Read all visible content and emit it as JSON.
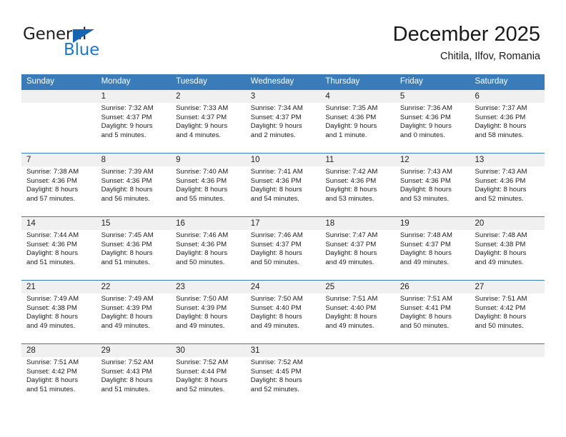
{
  "brand": {
    "name_part1": "General",
    "name_part2": "Blue",
    "triangle_color": "#1565b0",
    "text_color": "#231f20",
    "blue_color": "#2079c7"
  },
  "header": {
    "title": "December 2025",
    "subtitle": "Chitila, Ilfov, Romania",
    "header_bg": "#3a7cba",
    "daynum_bg": "#f0f0f0"
  },
  "weekdays": [
    "Sunday",
    "Monday",
    "Tuesday",
    "Wednesday",
    "Thursday",
    "Friday",
    "Saturday"
  ],
  "weeks": [
    {
      "days": [
        {
          "num": "",
          "sunrise": "",
          "sunset": "",
          "daylight1": "",
          "daylight2": ""
        },
        {
          "num": "1",
          "sunrise": "Sunrise: 7:32 AM",
          "sunset": "Sunset: 4:37 PM",
          "daylight1": "Daylight: 9 hours",
          "daylight2": "and 5 minutes."
        },
        {
          "num": "2",
          "sunrise": "Sunrise: 7:33 AM",
          "sunset": "Sunset: 4:37 PM",
          "daylight1": "Daylight: 9 hours",
          "daylight2": "and 4 minutes."
        },
        {
          "num": "3",
          "sunrise": "Sunrise: 7:34 AM",
          "sunset": "Sunset: 4:37 PM",
          "daylight1": "Daylight: 9 hours",
          "daylight2": "and 2 minutes."
        },
        {
          "num": "4",
          "sunrise": "Sunrise: 7:35 AM",
          "sunset": "Sunset: 4:36 PM",
          "daylight1": "Daylight: 9 hours",
          "daylight2": "and 1 minute."
        },
        {
          "num": "5",
          "sunrise": "Sunrise: 7:36 AM",
          "sunset": "Sunset: 4:36 PM",
          "daylight1": "Daylight: 9 hours",
          "daylight2": "and 0 minutes."
        },
        {
          "num": "6",
          "sunrise": "Sunrise: 7:37 AM",
          "sunset": "Sunset: 4:36 PM",
          "daylight1": "Daylight: 8 hours",
          "daylight2": "and 58 minutes."
        }
      ]
    },
    {
      "days": [
        {
          "num": "7",
          "sunrise": "Sunrise: 7:38 AM",
          "sunset": "Sunset: 4:36 PM",
          "daylight1": "Daylight: 8 hours",
          "daylight2": "and 57 minutes."
        },
        {
          "num": "8",
          "sunrise": "Sunrise: 7:39 AM",
          "sunset": "Sunset: 4:36 PM",
          "daylight1": "Daylight: 8 hours",
          "daylight2": "and 56 minutes."
        },
        {
          "num": "9",
          "sunrise": "Sunrise: 7:40 AM",
          "sunset": "Sunset: 4:36 PM",
          "daylight1": "Daylight: 8 hours",
          "daylight2": "and 55 minutes."
        },
        {
          "num": "10",
          "sunrise": "Sunrise: 7:41 AM",
          "sunset": "Sunset: 4:36 PM",
          "daylight1": "Daylight: 8 hours",
          "daylight2": "and 54 minutes."
        },
        {
          "num": "11",
          "sunrise": "Sunrise: 7:42 AM",
          "sunset": "Sunset: 4:36 PM",
          "daylight1": "Daylight: 8 hours",
          "daylight2": "and 53 minutes."
        },
        {
          "num": "12",
          "sunrise": "Sunrise: 7:43 AM",
          "sunset": "Sunset: 4:36 PM",
          "daylight1": "Daylight: 8 hours",
          "daylight2": "and 53 minutes."
        },
        {
          "num": "13",
          "sunrise": "Sunrise: 7:43 AM",
          "sunset": "Sunset: 4:36 PM",
          "daylight1": "Daylight: 8 hours",
          "daylight2": "and 52 minutes."
        }
      ]
    },
    {
      "days": [
        {
          "num": "14",
          "sunrise": "Sunrise: 7:44 AM",
          "sunset": "Sunset: 4:36 PM",
          "daylight1": "Daylight: 8 hours",
          "daylight2": "and 51 minutes."
        },
        {
          "num": "15",
          "sunrise": "Sunrise: 7:45 AM",
          "sunset": "Sunset: 4:36 PM",
          "daylight1": "Daylight: 8 hours",
          "daylight2": "and 51 minutes."
        },
        {
          "num": "16",
          "sunrise": "Sunrise: 7:46 AM",
          "sunset": "Sunset: 4:36 PM",
          "daylight1": "Daylight: 8 hours",
          "daylight2": "and 50 minutes."
        },
        {
          "num": "17",
          "sunrise": "Sunrise: 7:46 AM",
          "sunset": "Sunset: 4:37 PM",
          "daylight1": "Daylight: 8 hours",
          "daylight2": "and 50 minutes."
        },
        {
          "num": "18",
          "sunrise": "Sunrise: 7:47 AM",
          "sunset": "Sunset: 4:37 PM",
          "daylight1": "Daylight: 8 hours",
          "daylight2": "and 49 minutes."
        },
        {
          "num": "19",
          "sunrise": "Sunrise: 7:48 AM",
          "sunset": "Sunset: 4:37 PM",
          "daylight1": "Daylight: 8 hours",
          "daylight2": "and 49 minutes."
        },
        {
          "num": "20",
          "sunrise": "Sunrise: 7:48 AM",
          "sunset": "Sunset: 4:38 PM",
          "daylight1": "Daylight: 8 hours",
          "daylight2": "and 49 minutes."
        }
      ]
    },
    {
      "days": [
        {
          "num": "21",
          "sunrise": "Sunrise: 7:49 AM",
          "sunset": "Sunset: 4:38 PM",
          "daylight1": "Daylight: 8 hours",
          "daylight2": "and 49 minutes."
        },
        {
          "num": "22",
          "sunrise": "Sunrise: 7:49 AM",
          "sunset": "Sunset: 4:39 PM",
          "daylight1": "Daylight: 8 hours",
          "daylight2": "and 49 minutes."
        },
        {
          "num": "23",
          "sunrise": "Sunrise: 7:50 AM",
          "sunset": "Sunset: 4:39 PM",
          "daylight1": "Daylight: 8 hours",
          "daylight2": "and 49 minutes."
        },
        {
          "num": "24",
          "sunrise": "Sunrise: 7:50 AM",
          "sunset": "Sunset: 4:40 PM",
          "daylight1": "Daylight: 8 hours",
          "daylight2": "and 49 minutes."
        },
        {
          "num": "25",
          "sunrise": "Sunrise: 7:51 AM",
          "sunset": "Sunset: 4:40 PM",
          "daylight1": "Daylight: 8 hours",
          "daylight2": "and 49 minutes."
        },
        {
          "num": "26",
          "sunrise": "Sunrise: 7:51 AM",
          "sunset": "Sunset: 4:41 PM",
          "daylight1": "Daylight: 8 hours",
          "daylight2": "and 50 minutes."
        },
        {
          "num": "27",
          "sunrise": "Sunrise: 7:51 AM",
          "sunset": "Sunset: 4:42 PM",
          "daylight1": "Daylight: 8 hours",
          "daylight2": "and 50 minutes."
        }
      ]
    },
    {
      "days": [
        {
          "num": "28",
          "sunrise": "Sunrise: 7:51 AM",
          "sunset": "Sunset: 4:42 PM",
          "daylight1": "Daylight: 8 hours",
          "daylight2": "and 51 minutes."
        },
        {
          "num": "29",
          "sunrise": "Sunrise: 7:52 AM",
          "sunset": "Sunset: 4:43 PM",
          "daylight1": "Daylight: 8 hours",
          "daylight2": "and 51 minutes."
        },
        {
          "num": "30",
          "sunrise": "Sunrise: 7:52 AM",
          "sunset": "Sunset: 4:44 PM",
          "daylight1": "Daylight: 8 hours",
          "daylight2": "and 52 minutes."
        },
        {
          "num": "31",
          "sunrise": "Sunrise: 7:52 AM",
          "sunset": "Sunset: 4:45 PM",
          "daylight1": "Daylight: 8 hours",
          "daylight2": "and 52 minutes."
        },
        {
          "num": "",
          "sunrise": "",
          "sunset": "",
          "daylight1": "",
          "daylight2": ""
        },
        {
          "num": "",
          "sunrise": "",
          "sunset": "",
          "daylight1": "",
          "daylight2": ""
        },
        {
          "num": "",
          "sunrise": "",
          "sunset": "",
          "daylight1": "",
          "daylight2": ""
        }
      ]
    }
  ]
}
